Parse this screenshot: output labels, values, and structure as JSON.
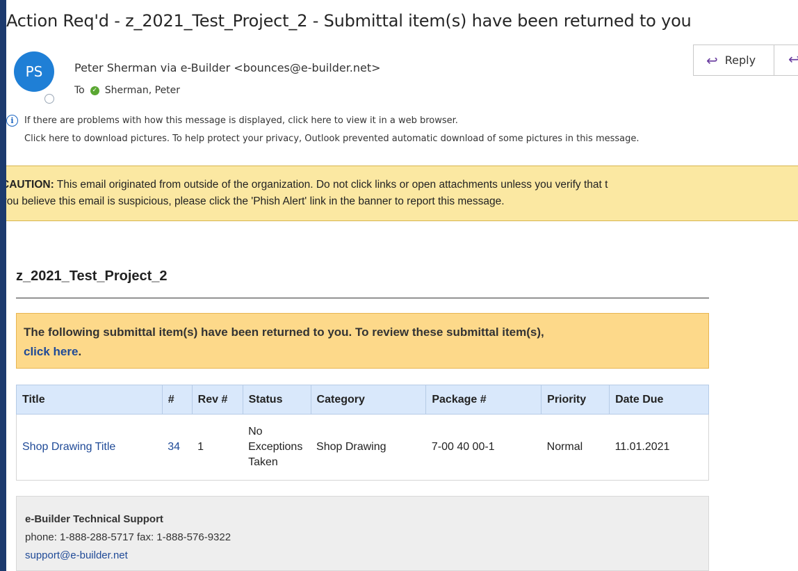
{
  "email": {
    "subject": "Action Req'd - z_2021_Test_Project_2 - Submittal item(s) have been returned to you",
    "avatar_initials": "PS",
    "sender": "Peter Sherman via e-Builder <bounces@e-builder.net>",
    "to_label": "To",
    "recipient": "Sherman, Peter",
    "reply_label": "Reply",
    "info_line_1": "If there are problems with how this message is displayed, click here to view it in a web browser.",
    "info_line_2": "Click here to download pictures. To help protect your privacy, Outlook prevented automatic download of some pictures in this message."
  },
  "caution": {
    "label": "CAUTION:",
    "line_1_rest": " This email originated from outside of the organization. Do not click links or open attachments unless you verify that t",
    "line_2": "you believe this email is suspicious, please click the 'Phish Alert' link in the banner to report this message."
  },
  "body": {
    "project_title": "z_2021_Test_Project_2",
    "notice_text": "The following submittal item(s) have been returned to you. To review these submittal item(s),",
    "notice_link": "click here",
    "notice_end": "."
  },
  "table": {
    "headers": [
      "Title",
      "#",
      "Rev #",
      "Status",
      "Category",
      "Package #",
      "Priority",
      "Date Due"
    ],
    "rows": [
      {
        "title": "Shop Drawing Title",
        "number": "34",
        "rev": "1",
        "status_l1": "No",
        "status_l2": "Exceptions",
        "status_l3": "Taken",
        "category": "Shop Drawing",
        "package": "7-00 40 00-1",
        "priority": "Normal",
        "date_due": "11.01.2021"
      }
    ]
  },
  "support": {
    "name": "e-Builder Technical Support",
    "phone_fax": "phone: 1-888-288-5717 fax: 1-888-576-9322",
    "email": "support@e-builder.net"
  },
  "colors": {
    "frame": "#1c3a6e",
    "avatar": "#1f7fd6",
    "caution_bg": "#fbe8a2",
    "notice_bg": "#fdd98a",
    "table_header_bg": "#d9e8fb",
    "link": "#1f4a97",
    "support_bg": "#eeeeee"
  }
}
